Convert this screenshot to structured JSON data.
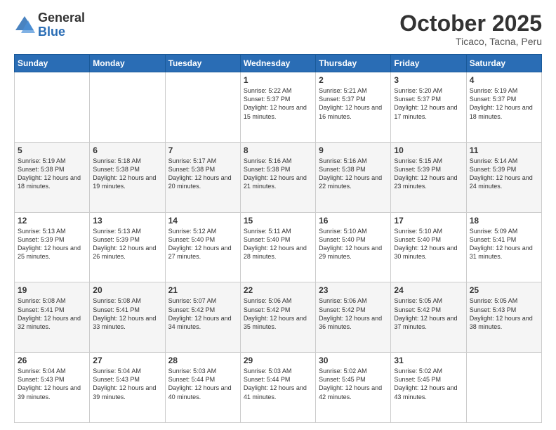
{
  "header": {
    "logo_general": "General",
    "logo_blue": "Blue",
    "title": "October 2025",
    "subtitle": "Ticaco, Tacna, Peru"
  },
  "weekdays": [
    "Sunday",
    "Monday",
    "Tuesday",
    "Wednesday",
    "Thursday",
    "Friday",
    "Saturday"
  ],
  "weeks": [
    [
      {
        "day": "",
        "info": ""
      },
      {
        "day": "",
        "info": ""
      },
      {
        "day": "",
        "info": ""
      },
      {
        "day": "1",
        "info": "Sunrise: 5:22 AM\nSunset: 5:37 PM\nDaylight: 12 hours\nand 15 minutes."
      },
      {
        "day": "2",
        "info": "Sunrise: 5:21 AM\nSunset: 5:37 PM\nDaylight: 12 hours\nand 16 minutes."
      },
      {
        "day": "3",
        "info": "Sunrise: 5:20 AM\nSunset: 5:37 PM\nDaylight: 12 hours\nand 17 minutes."
      },
      {
        "day": "4",
        "info": "Sunrise: 5:19 AM\nSunset: 5:37 PM\nDaylight: 12 hours\nand 18 minutes."
      }
    ],
    [
      {
        "day": "5",
        "info": "Sunrise: 5:19 AM\nSunset: 5:38 PM\nDaylight: 12 hours\nand 18 minutes."
      },
      {
        "day": "6",
        "info": "Sunrise: 5:18 AM\nSunset: 5:38 PM\nDaylight: 12 hours\nand 19 minutes."
      },
      {
        "day": "7",
        "info": "Sunrise: 5:17 AM\nSunset: 5:38 PM\nDaylight: 12 hours\nand 20 minutes."
      },
      {
        "day": "8",
        "info": "Sunrise: 5:16 AM\nSunset: 5:38 PM\nDaylight: 12 hours\nand 21 minutes."
      },
      {
        "day": "9",
        "info": "Sunrise: 5:16 AM\nSunset: 5:38 PM\nDaylight: 12 hours\nand 22 minutes."
      },
      {
        "day": "10",
        "info": "Sunrise: 5:15 AM\nSunset: 5:39 PM\nDaylight: 12 hours\nand 23 minutes."
      },
      {
        "day": "11",
        "info": "Sunrise: 5:14 AM\nSunset: 5:39 PM\nDaylight: 12 hours\nand 24 minutes."
      }
    ],
    [
      {
        "day": "12",
        "info": "Sunrise: 5:13 AM\nSunset: 5:39 PM\nDaylight: 12 hours\nand 25 minutes."
      },
      {
        "day": "13",
        "info": "Sunrise: 5:13 AM\nSunset: 5:39 PM\nDaylight: 12 hours\nand 26 minutes."
      },
      {
        "day": "14",
        "info": "Sunrise: 5:12 AM\nSunset: 5:40 PM\nDaylight: 12 hours\nand 27 minutes."
      },
      {
        "day": "15",
        "info": "Sunrise: 5:11 AM\nSunset: 5:40 PM\nDaylight: 12 hours\nand 28 minutes."
      },
      {
        "day": "16",
        "info": "Sunrise: 5:10 AM\nSunset: 5:40 PM\nDaylight: 12 hours\nand 29 minutes."
      },
      {
        "day": "17",
        "info": "Sunrise: 5:10 AM\nSunset: 5:40 PM\nDaylight: 12 hours\nand 30 minutes."
      },
      {
        "day": "18",
        "info": "Sunrise: 5:09 AM\nSunset: 5:41 PM\nDaylight: 12 hours\nand 31 minutes."
      }
    ],
    [
      {
        "day": "19",
        "info": "Sunrise: 5:08 AM\nSunset: 5:41 PM\nDaylight: 12 hours\nand 32 minutes."
      },
      {
        "day": "20",
        "info": "Sunrise: 5:08 AM\nSunset: 5:41 PM\nDaylight: 12 hours\nand 33 minutes."
      },
      {
        "day": "21",
        "info": "Sunrise: 5:07 AM\nSunset: 5:42 PM\nDaylight: 12 hours\nand 34 minutes."
      },
      {
        "day": "22",
        "info": "Sunrise: 5:06 AM\nSunset: 5:42 PM\nDaylight: 12 hours\nand 35 minutes."
      },
      {
        "day": "23",
        "info": "Sunrise: 5:06 AM\nSunset: 5:42 PM\nDaylight: 12 hours\nand 36 minutes."
      },
      {
        "day": "24",
        "info": "Sunrise: 5:05 AM\nSunset: 5:42 PM\nDaylight: 12 hours\nand 37 minutes."
      },
      {
        "day": "25",
        "info": "Sunrise: 5:05 AM\nSunset: 5:43 PM\nDaylight: 12 hours\nand 38 minutes."
      }
    ],
    [
      {
        "day": "26",
        "info": "Sunrise: 5:04 AM\nSunset: 5:43 PM\nDaylight: 12 hours\nand 39 minutes."
      },
      {
        "day": "27",
        "info": "Sunrise: 5:04 AM\nSunset: 5:43 PM\nDaylight: 12 hours\nand 39 minutes."
      },
      {
        "day": "28",
        "info": "Sunrise: 5:03 AM\nSunset: 5:44 PM\nDaylight: 12 hours\nand 40 minutes."
      },
      {
        "day": "29",
        "info": "Sunrise: 5:03 AM\nSunset: 5:44 PM\nDaylight: 12 hours\nand 41 minutes."
      },
      {
        "day": "30",
        "info": "Sunrise: 5:02 AM\nSunset: 5:45 PM\nDaylight: 12 hours\nand 42 minutes."
      },
      {
        "day": "31",
        "info": "Sunrise: 5:02 AM\nSunset: 5:45 PM\nDaylight: 12 hours\nand 43 minutes."
      },
      {
        "day": "",
        "info": ""
      }
    ]
  ]
}
